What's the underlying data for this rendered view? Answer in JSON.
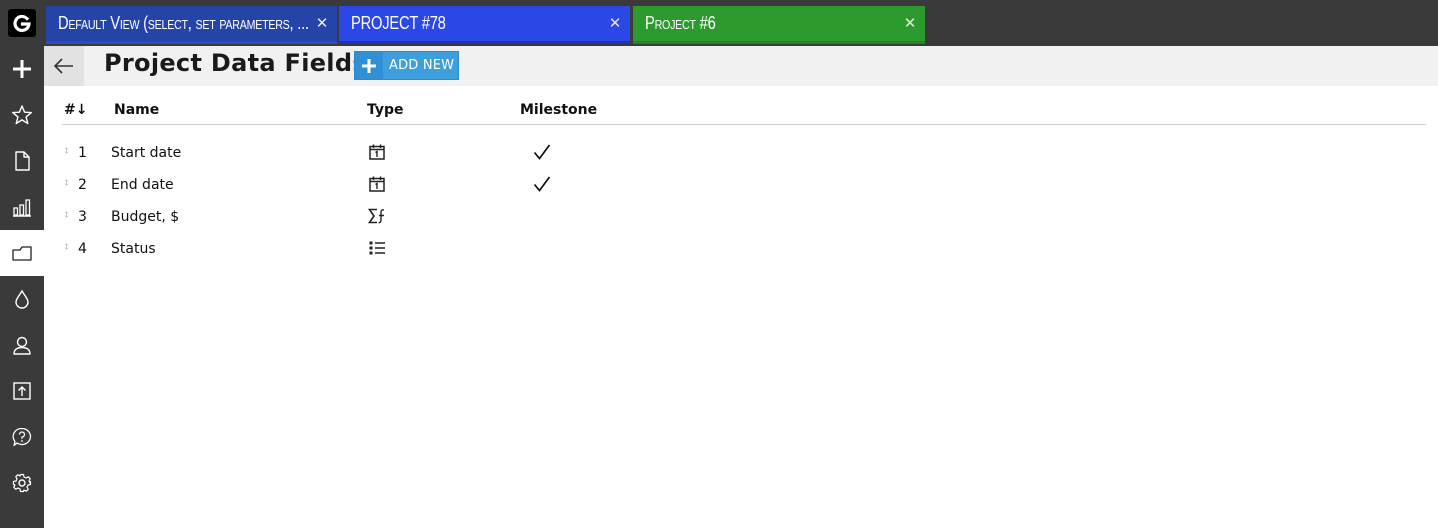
{
  "app": {
    "logo_icon": "g-logo-icon"
  },
  "sidebar": {
    "items": [
      {
        "icon": "plus-icon"
      },
      {
        "icon": "star-icon"
      },
      {
        "icon": "document-icon"
      },
      {
        "icon": "bar-chart-icon"
      },
      {
        "icon": "folder-icon",
        "active": true
      },
      {
        "icon": "drop-icon"
      },
      {
        "icon": "user-icon"
      },
      {
        "icon": "upload-icon"
      },
      {
        "icon": "help-icon"
      },
      {
        "icon": "gear-icon"
      }
    ]
  },
  "tabs": [
    {
      "label": "Default View (select, set parameters, ...",
      "color": "#2544a8"
    },
    {
      "label": "PROJECT #78",
      "color": "#2b47e6"
    },
    {
      "label": "Project #6",
      "color": "#2d9a2d"
    }
  ],
  "header": {
    "title": "Project Data Fields",
    "add_button_label": "ADD NEW",
    "accent_color": "#3d9fdc"
  },
  "table": {
    "columns": {
      "num": "#↓",
      "name": "Name",
      "type": "Type",
      "milestone": "Milestone"
    },
    "rows": [
      {
        "num": "1",
        "name": "Start date",
        "type_icon": "calendar-icon",
        "milestone": true
      },
      {
        "num": "2",
        "name": "End date",
        "type_icon": "calendar-icon",
        "milestone": true
      },
      {
        "num": "3",
        "name": "Budget, $",
        "type_icon": "formula-icon",
        "milestone": false
      },
      {
        "num": "4",
        "name": "Status",
        "type_icon": "list-icon",
        "milestone": false
      }
    ]
  }
}
